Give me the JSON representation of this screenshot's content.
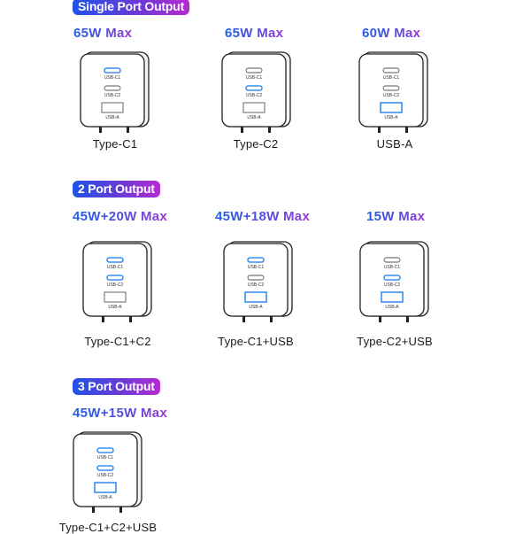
{
  "sections": [
    {
      "badge": "Single Port Output",
      "items": [
        {
          "watt": "65W Max",
          "label": "Type-C1",
          "active": [
            "c1"
          ]
        },
        {
          "watt": "65W Max",
          "label": "Type-C2",
          "active": [
            "c2"
          ]
        },
        {
          "watt": "60W Max",
          "label": "USB-A",
          "active": [
            "a"
          ]
        }
      ]
    },
    {
      "badge": "2 Port Output",
      "items": [
        {
          "watt": "45W+20W Max",
          "label": "Type-C1+C2",
          "active": [
            "c1",
            "c2"
          ]
        },
        {
          "watt": "45W+18W Max",
          "label": "Type-C1+USB",
          "active": [
            "c1",
            "a"
          ]
        },
        {
          "watt": "15W Max",
          "label": "Type-C2+USB",
          "active": [
            "c2",
            "a"
          ]
        }
      ]
    },
    {
      "badge": "3 Port Output",
      "items": [
        {
          "watt": "45W+15W Max",
          "label": "Type-C1+C2+USB",
          "active": [
            "c1",
            "c2",
            "a"
          ]
        }
      ]
    }
  ],
  "port_labels": {
    "c1": "USB-C1",
    "c2": "USB-C2",
    "a": "USB-A"
  },
  "colors": {
    "active_port": "#3a8ef0",
    "inactive_port": "#555555",
    "outline": "#222222"
  }
}
